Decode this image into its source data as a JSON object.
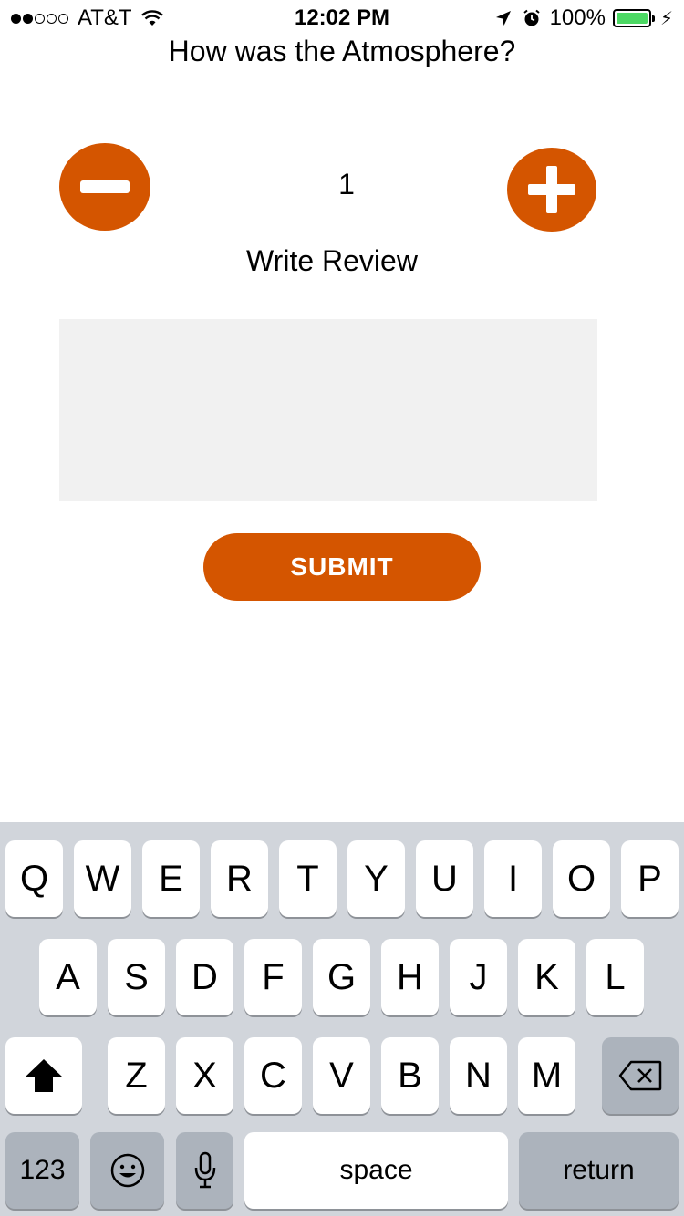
{
  "status_bar": {
    "carrier": "AT&T",
    "time": "12:02 PM",
    "battery": "100%",
    "battery_color": "#4cd964"
  },
  "form": {
    "question": "How was the Atmosphere?",
    "stepper_value": "1",
    "minus_icon": "minus-circle-icon",
    "plus_icon": "plus-circle-icon",
    "write_review_label": "Write Review",
    "review_text": "",
    "submit_label": "SUBMIT",
    "accent_color": "#d45500"
  },
  "keyboard": {
    "row1": [
      "Q",
      "W",
      "E",
      "R",
      "T",
      "Y",
      "U",
      "I",
      "O",
      "P"
    ],
    "row2": [
      "A",
      "S",
      "D",
      "F",
      "G",
      "H",
      "J",
      "K",
      "L"
    ],
    "row3": [
      "Z",
      "X",
      "C",
      "V",
      "B",
      "N",
      "M"
    ],
    "numbers_label": "123",
    "space_label": "space",
    "return_label": "return",
    "shift_icon": "shift-arrow-icon",
    "delete_icon": "backspace-icon",
    "emoji_icon": "emoji-icon",
    "mic_icon": "microphone-icon"
  }
}
